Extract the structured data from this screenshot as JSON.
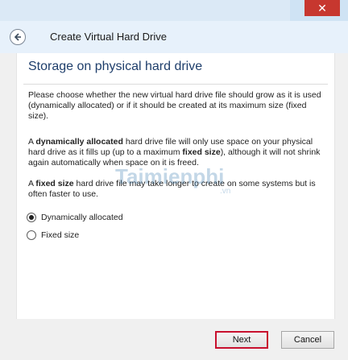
{
  "window": {
    "title": "Create Virtual Hard Drive",
    "close_symbol": "✕"
  },
  "header": {
    "back_icon": "back-arrow-icon",
    "title": "Create Virtual Hard Drive"
  },
  "content": {
    "section_title": "Storage on physical hard drive",
    "paragraph1": "Please choose whether the new virtual hard drive file should grow as it is used (dynamically allocated) or if it should be created at its maximum size (fixed size).",
    "paragraph2": {
      "lead": "A ",
      "bold1": "dynamically allocated",
      "mid1": " hard drive file will only use space on your physical hard drive as it fills up (up to a maximum ",
      "bold2": "fixed size",
      "tail": "), although it will not shrink again automatically when space on it is freed."
    },
    "paragraph3": {
      "lead": "A ",
      "bold": "fixed size",
      "tail": " hard drive file may take longer to create on some systems but is often faster to use."
    },
    "options": [
      {
        "label": "Dynamically allocated",
        "selected": true
      },
      {
        "label": "Fixed size",
        "selected": false
      }
    ],
    "watermark": "Taimienphi",
    "watermark_sub": ".vn"
  },
  "footer": {
    "next_label": "Next",
    "cancel_label": "Cancel"
  },
  "colors": {
    "close": "#c7372f",
    "highlight_border": "#c8102e",
    "section_title": "#1e3e6b"
  }
}
